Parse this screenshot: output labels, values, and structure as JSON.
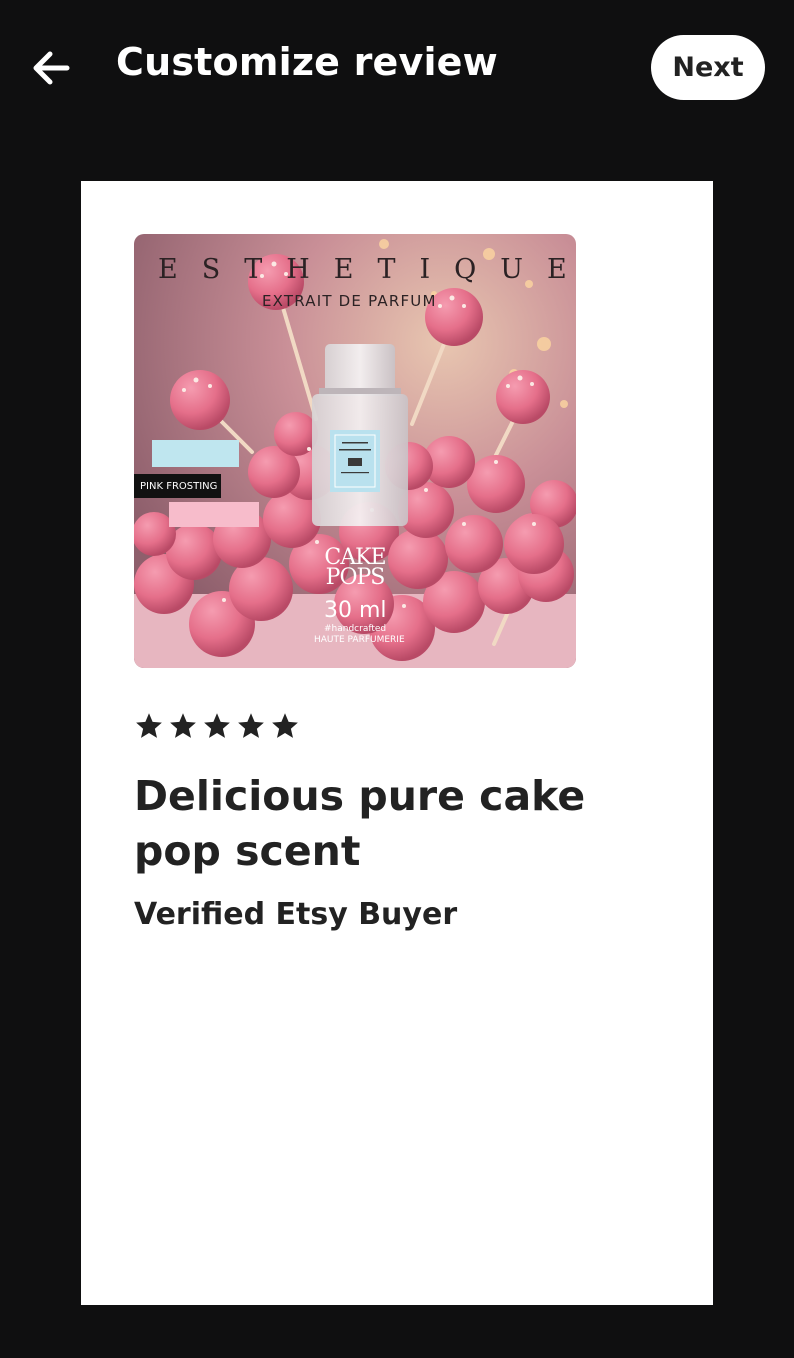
{
  "header": {
    "back_icon": "arrow-left-icon",
    "title": "Customize review",
    "next_label": "Next"
  },
  "review": {
    "rating": 5,
    "rating_max": 5,
    "star_icon": "star-icon",
    "title": "Delicious pure cake pop scent",
    "reviewer": "Verified Etsy Buyer",
    "photo": {
      "brand": "ESTHETIQUE",
      "subtitle": "EXTRAIT DE PARFUM",
      "tag_1": "",
      "tag_2": "PINK FROSTING",
      "tag_3": "",
      "product_line1": "CAKE",
      "product_line2": "POPS",
      "volume": "30 ml",
      "small_line1": "#handcrafted",
      "small_line2": "HAUTE PARFUMERIE"
    }
  },
  "colors": {
    "background": "#0f0f10",
    "card": "#ffffff",
    "text": "#222222",
    "accent_pink": "#e96f8a"
  }
}
